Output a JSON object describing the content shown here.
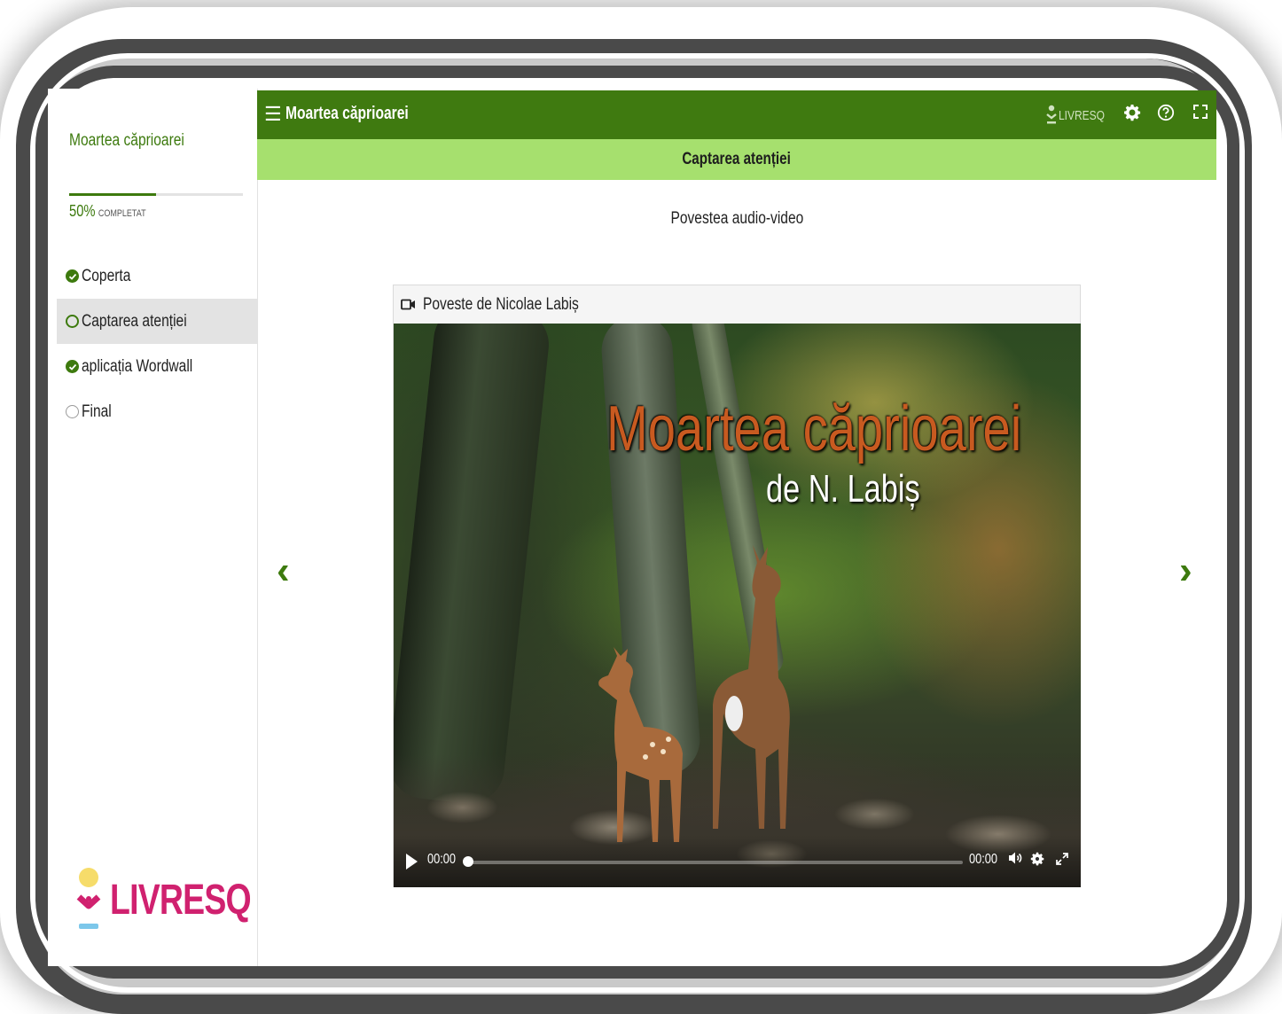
{
  "app": {
    "title": "Moartea căprioarei",
    "brand": "LIVRESQ",
    "brand_color": "#d0216f",
    "accent_dark": "#3f7a10",
    "accent_light": "#a6e06e"
  },
  "sidebar": {
    "title": "Moartea căprioarei",
    "progress": {
      "percent_value": 0.5,
      "percent_label": "50%",
      "word": "COMPLETAT"
    },
    "items": [
      {
        "label": "Coperta",
        "status": "done"
      },
      {
        "label": "Captarea atenției",
        "status": "current"
      },
      {
        "label": "aplicația Wordwall",
        "status": "done"
      },
      {
        "label": "Final",
        "status": "todo"
      }
    ]
  },
  "topbar": {
    "menu_icon": "hamburger-icon",
    "title": "Moartea căprioarei",
    "brand_small": "LIVRESQ",
    "icons": [
      "gear-icon",
      "help-icon",
      "fullscreen-icon"
    ]
  },
  "subbar": {
    "section": "Captarea atenției"
  },
  "main": {
    "heading": "Povestea audio-video",
    "video": {
      "header_icon": "video-camera-icon",
      "header": "Poveste de Nicolae Labiș",
      "frame_title": "Moartea căprioarei",
      "frame_subtitle": "de N. Labiș",
      "current_time": "00:00",
      "duration": "00:00",
      "progress": 0
    },
    "prev_icon": "chevron-left-icon",
    "next_icon": "chevron-right-icon"
  }
}
